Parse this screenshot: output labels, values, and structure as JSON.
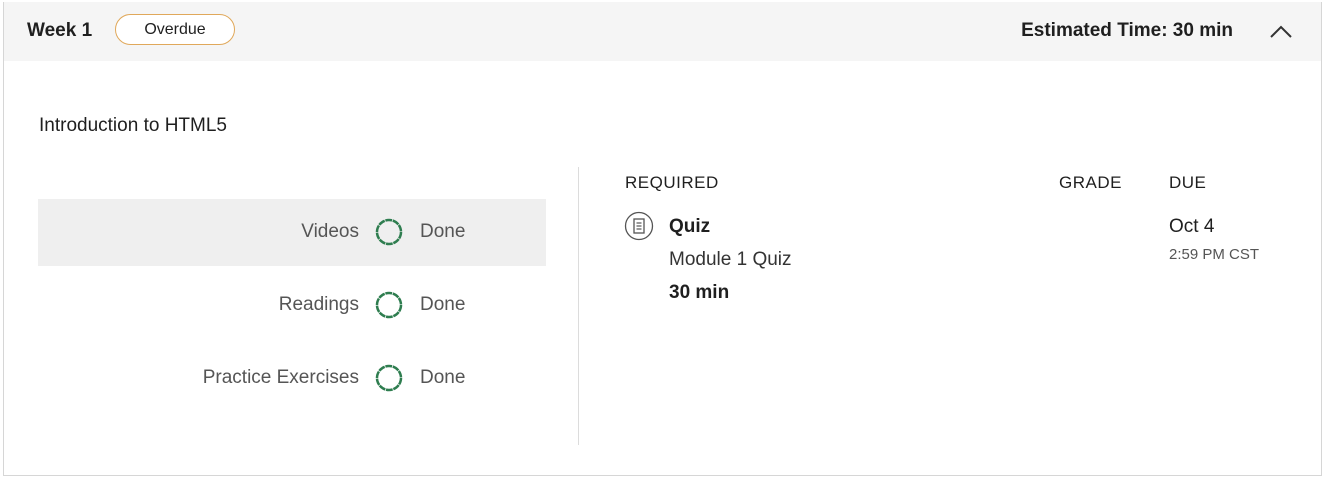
{
  "header": {
    "week_label": "Week 1",
    "badge": "Overdue",
    "estimated_time": "Estimated Time: 30 min",
    "collapse_icon": "chevron-up-icon"
  },
  "module": {
    "title": "Introduction to HTML5",
    "progress": [
      {
        "label": "Videos",
        "status": "Done",
        "icon": "progress-ring-icon"
      },
      {
        "label": "Readings",
        "status": "Done",
        "icon": "progress-ring-icon"
      },
      {
        "label": "Practice Exercises",
        "status": "Done",
        "icon": "progress-ring-icon"
      }
    ]
  },
  "table": {
    "headers": {
      "required": "REQUIRED",
      "grade": "GRADE",
      "due": "DUE"
    },
    "items": [
      {
        "icon": "quiz-document-icon",
        "type": "Quiz",
        "name": "Module 1 Quiz",
        "duration": "30 min",
        "grade": "",
        "due_date": "Oct 4",
        "due_time": "2:59 PM CST"
      }
    ]
  },
  "colors": {
    "badge_border": "#e0a85a",
    "ring_green": "#2e7d4f",
    "header_bg": "#f5f5f5",
    "active_row_bg": "#efefef"
  }
}
